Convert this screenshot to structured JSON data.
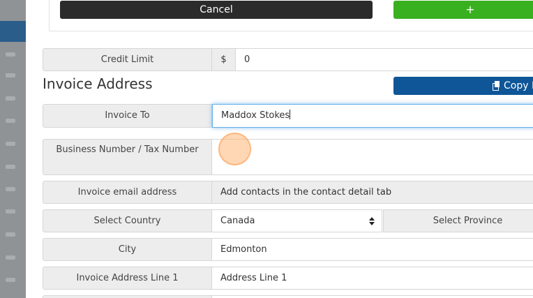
{
  "buttons": {
    "cancel_label": "Cancel",
    "add_label": "+",
    "copy_label": "Copy F"
  },
  "credit_limit": {
    "label": "Credit Limit",
    "currency": "$",
    "value": "0"
  },
  "invoice_section": {
    "title": "Invoice Address"
  },
  "fields": {
    "invoice_to": {
      "label": "Invoice To",
      "value": "Maddox Stokes"
    },
    "tax_number": {
      "label": "Business Number / Tax Number",
      "value": ""
    },
    "invoice_email": {
      "label": "Invoice email address",
      "value": "Add contacts in the contact detail tab"
    },
    "country": {
      "label": "Select Country",
      "value": "Canada"
    },
    "province": {
      "label": "Select Province"
    },
    "city": {
      "label": "City",
      "value": "Edmonton"
    },
    "address_line_1": {
      "label": "Invoice Address Line 1",
      "value": "Address Line 1"
    }
  },
  "colors": {
    "cancel": "#2b2b2b",
    "add": "#39b01f",
    "copy": "#0e5697",
    "focus": "#66afe9"
  },
  "icons": {
    "copy": "copy-icon",
    "select": "select-arrows-icon"
  }
}
